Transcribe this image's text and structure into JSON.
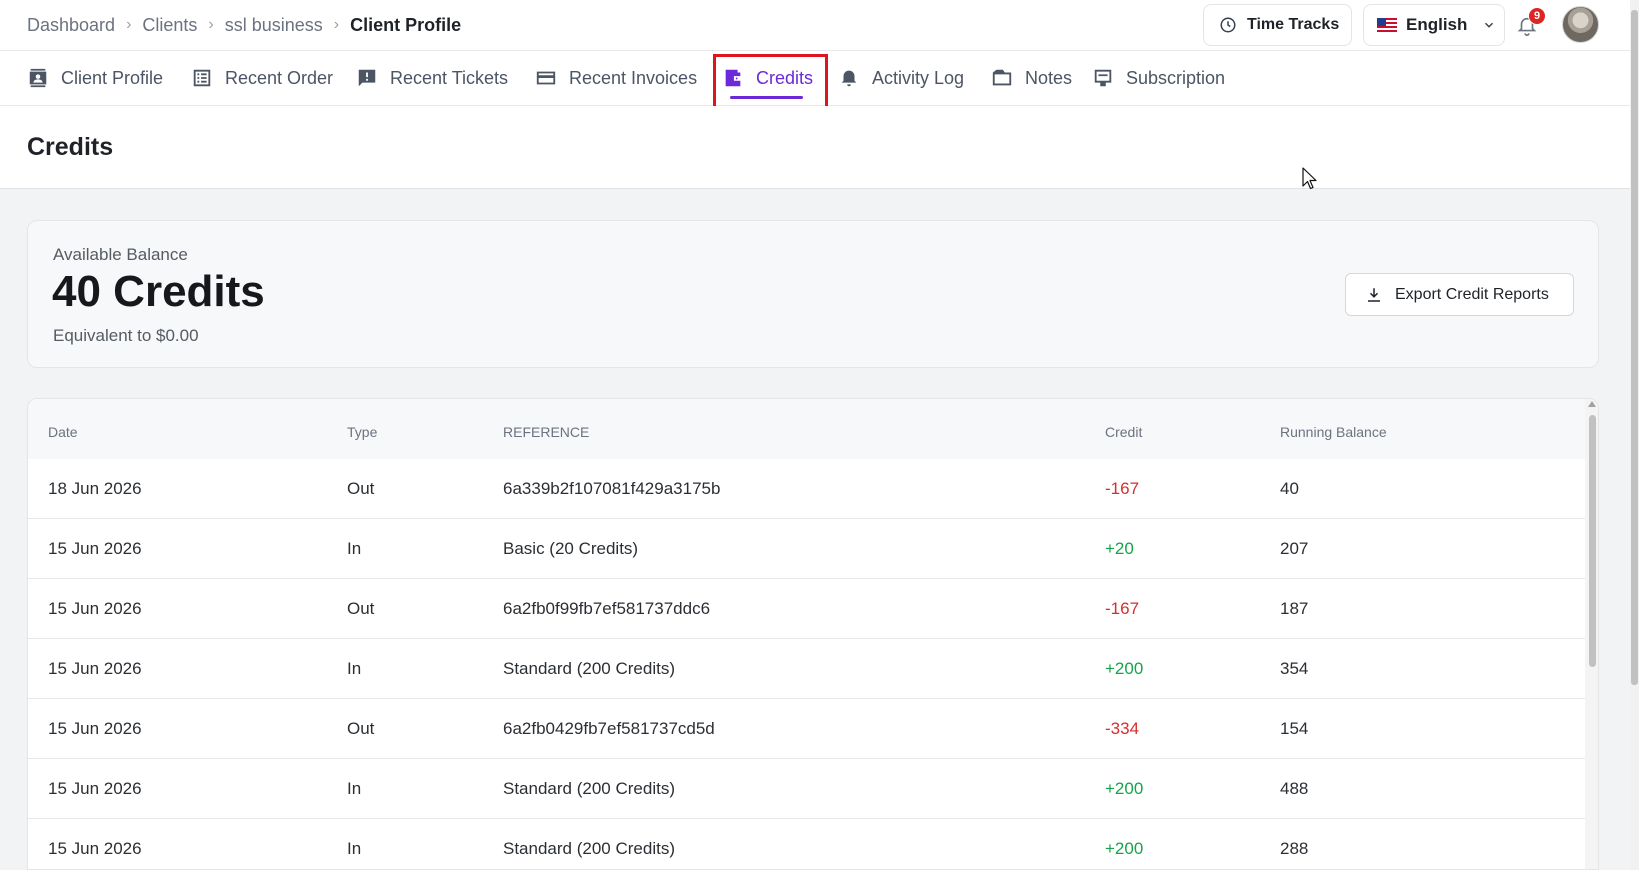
{
  "breadcrumb": {
    "items": [
      "Dashboard",
      "Clients",
      "ssl business"
    ],
    "current": "Client Profile"
  },
  "header": {
    "time_tracks_label": "Time Tracks",
    "language_label": "English",
    "notification_count": "9"
  },
  "tabs": [
    {
      "label": "Client Profile",
      "icon": "contact-card-icon"
    },
    {
      "label": "Recent Order",
      "icon": "list-icon"
    },
    {
      "label": "Recent Tickets",
      "icon": "ticket-alert-icon"
    },
    {
      "label": "Recent Invoices",
      "icon": "credit-card-icon"
    },
    {
      "label": "Credits",
      "icon": "wallet-icon",
      "active": true
    },
    {
      "label": "Activity Log",
      "icon": "bell-icon"
    },
    {
      "label": "Notes",
      "icon": "folder-icon"
    },
    {
      "label": "Subscription",
      "icon": "subscription-icon"
    }
  ],
  "page": {
    "title": "Credits"
  },
  "balance": {
    "label": "Available Balance",
    "value": "40 Credits",
    "equivalent": "Equivalent to $0.00",
    "export_label": "Export Credit Reports"
  },
  "table": {
    "headers": [
      "Date",
      "Type",
      "REFERENCE",
      "Credit",
      "Running Balance"
    ],
    "rows": [
      {
        "date": "18 Jun 2026",
        "type": "Out",
        "reference": "6a339b2f107081f429a3175b",
        "credit": "-167",
        "balance": "40"
      },
      {
        "date": "15 Jun 2026",
        "type": "In",
        "reference": "Basic (20 Credits)",
        "credit": "+20",
        "balance": "207"
      },
      {
        "date": "15 Jun 2026",
        "type": "Out",
        "reference": "6a2fb0f99fb7ef581737ddc6",
        "credit": "-167",
        "balance": "187"
      },
      {
        "date": "15 Jun 2026",
        "type": "In",
        "reference": "Standard (200 Credits)",
        "credit": "+200",
        "balance": "354"
      },
      {
        "date": "15 Jun 2026",
        "type": "Out",
        "reference": "6a2fb0429fb7ef581737cd5d",
        "credit": "-334",
        "balance": "154"
      },
      {
        "date": "15 Jun 2026",
        "type": "In",
        "reference": "Standard (200 Credits)",
        "credit": "+200",
        "balance": "488"
      },
      {
        "date": "15 Jun 2026",
        "type": "In",
        "reference": "Standard (200 Credits)",
        "credit": "+200",
        "balance": "288"
      }
    ]
  },
  "colors": {
    "accent": "#6d28d9",
    "negative": "#d62e2e",
    "positive": "#16a34a",
    "highlight": "#e0141e"
  }
}
